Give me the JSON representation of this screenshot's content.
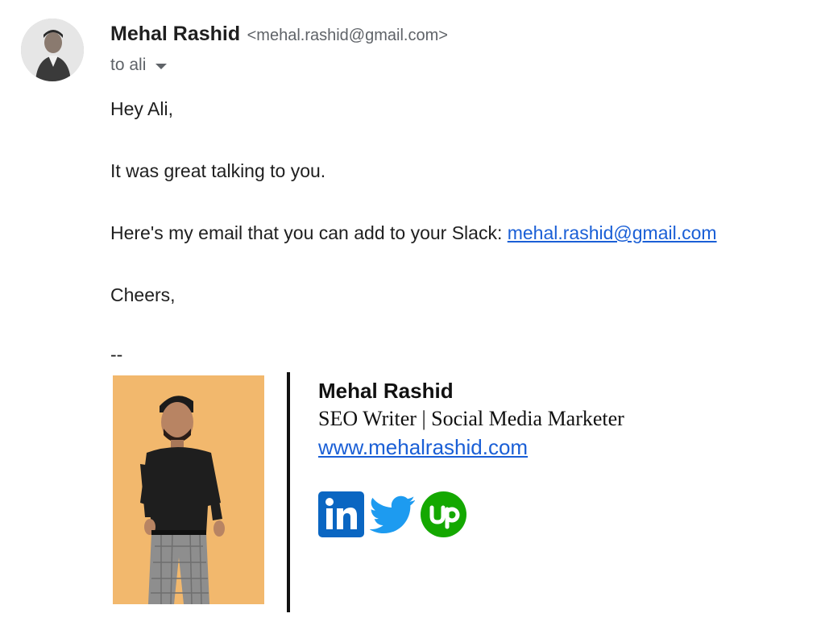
{
  "header": {
    "sender_name": "Mehal Rashid",
    "sender_email": "<mehal.rashid@gmail.com>",
    "to_label": "to ali"
  },
  "body": {
    "greeting": "Hey Ali,",
    "line1": "It was great talking to you.",
    "line2_prefix": "Here's my email that you can add to your Slack: ",
    "line2_link": "mehal.rashid@gmail.com",
    "closing": "Cheers,",
    "separator": "--"
  },
  "signature": {
    "name": "Mehal Rashid",
    "title": "SEO Writer | Social Media Marketer",
    "website": "www.mehalrashid.com",
    "social_icons": [
      "linkedin-icon",
      "twitter-icon",
      "upwork-icon"
    ],
    "photo_background": "#f2b86d"
  },
  "colors": {
    "link": "#1a5fd6",
    "linkedin": "#0a66c2",
    "twitter": "#1d9bf0",
    "upwork": "#14a800"
  }
}
